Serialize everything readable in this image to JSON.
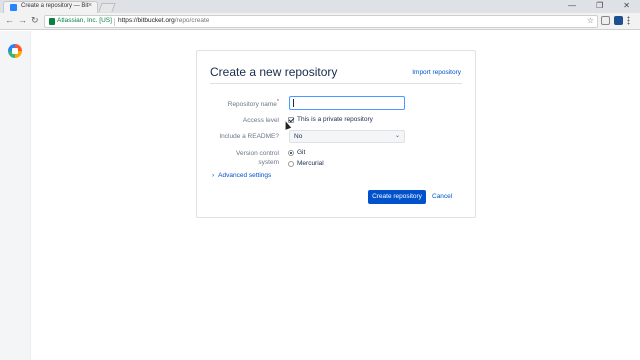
{
  "browser": {
    "tab_title": "Create a repository — Bit",
    "tab_close": "×",
    "window_controls": [
      "—",
      "❐",
      "✕"
    ],
    "secure_label": "Atlassian, Inc. [US]",
    "url_scheme_host": "https://bitbucket.org",
    "url_path": "/repo/create",
    "back_glyph": "←",
    "forward_glyph": "→",
    "reload_glyph": "↻",
    "star_glyph": "☆"
  },
  "form": {
    "title": "Create a new repository",
    "import_link": "Import repository",
    "repo_name_label": "Repository name",
    "required_mark": "*",
    "repo_name_value": "",
    "access_label": "Access level",
    "private_label": "This is a private repository",
    "private_checked": true,
    "readme_label": "Include a README?",
    "readme_value": "No",
    "vcs_label_line1": "Version control",
    "vcs_label_line2": "system",
    "vcs_options": [
      "Git",
      "Mercurial"
    ],
    "vcs_selected": "Git",
    "advanced": "Advanced settings",
    "advanced_icon": "›",
    "chevron": "⌄",
    "create_button": "Create repository",
    "cancel_link": "Cancel"
  },
  "colors": {
    "primary": "#0052cc",
    "focus": "#4c9aff",
    "secure_green": "#0b8043"
  }
}
